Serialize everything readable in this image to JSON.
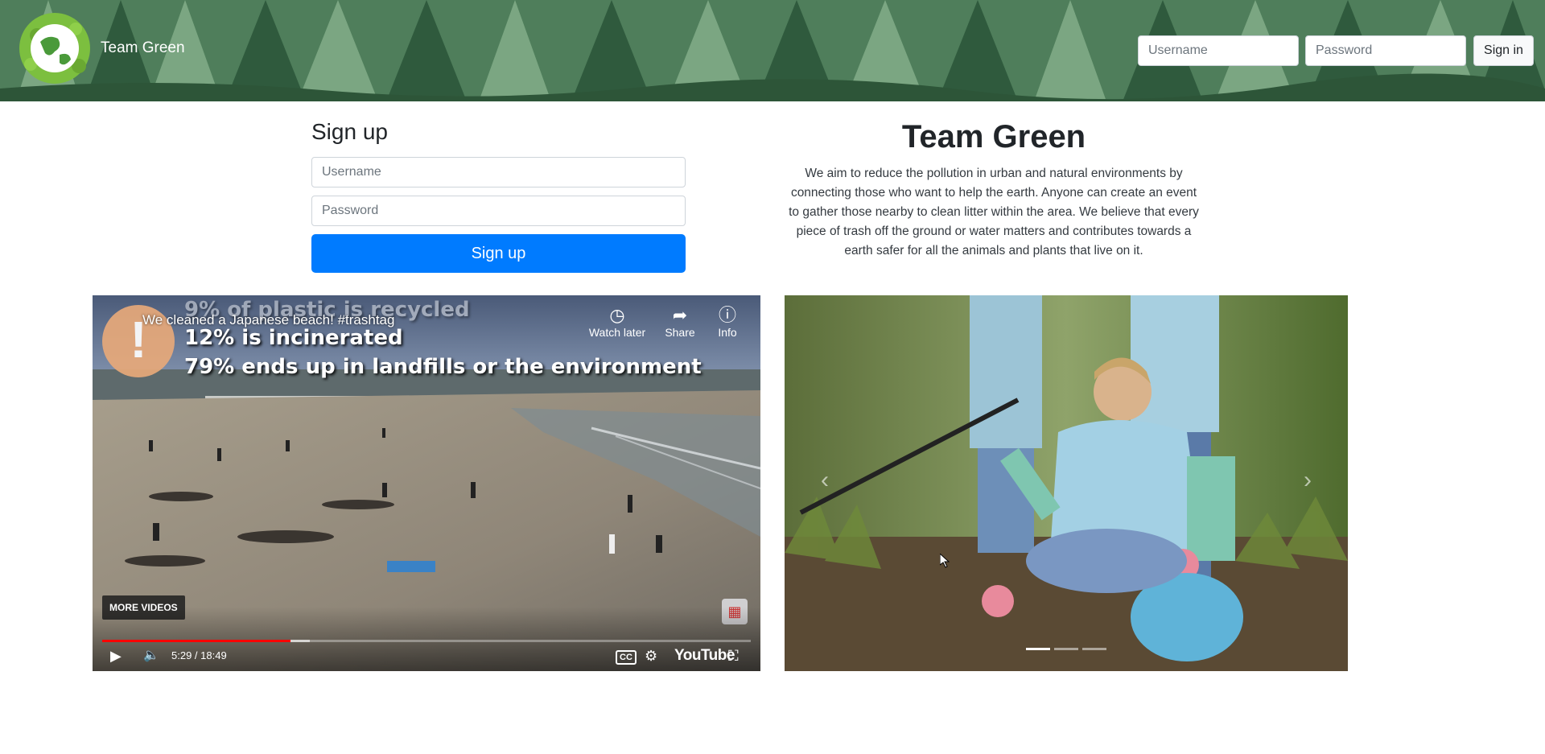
{
  "header": {
    "brand": "Team Green",
    "username_placeholder": "Username",
    "password_placeholder": "Password",
    "signin_label": "Sign in"
  },
  "signup": {
    "title": "Sign up",
    "username_placeholder": "Username",
    "password_placeholder": "Password",
    "button_label": "Sign up"
  },
  "about": {
    "title": "Team Green",
    "text": "We aim to reduce the pollution in urban and natural environments by connecting those who want to help the earth. Anyone can create an event to gather those nearby to clean litter within the area. We believe that every piece of trash off the ground or water matters and contributes towards a earth safer for all the animals and plants that live on it."
  },
  "video": {
    "title": "We cleaned a Japanese beach! #trashtag",
    "overlay_lines": [
      "9% of plastic is recycled",
      "12% is incinerated",
      "79% ends up in landfills or the environment"
    ],
    "actions": [
      {
        "label": "Watch later",
        "icon": "clock-icon"
      },
      {
        "label": "Share",
        "icon": "share-icon"
      },
      {
        "label": "Info",
        "icon": "info-icon"
      }
    ],
    "more_videos": "MORE VIDEOS",
    "time": "5:29 / 18:49",
    "progress_fraction": 0.29,
    "buffer_fraction": 0.32,
    "cc_label": "CC",
    "youtube_label": "YouTube",
    "colors": {
      "progress": "#ff0000"
    }
  },
  "carousel": {
    "slide_count": 3,
    "active_index": 0,
    "image": "volunteers-picking-up-litter-photo"
  },
  "colors": {
    "primary": "#007bff",
    "header_green": "#3f6b4c"
  }
}
